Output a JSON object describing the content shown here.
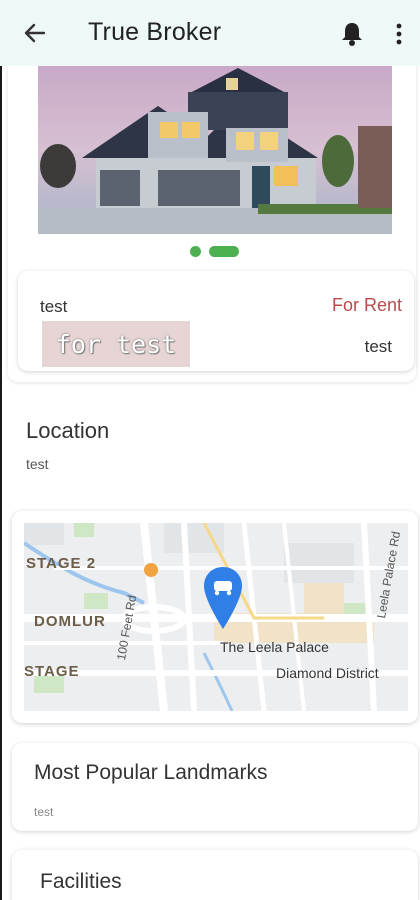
{
  "appbar": {
    "title": "True Broker",
    "back_icon": "arrow-left-icon",
    "notification_icon": "bell-icon",
    "menu_icon": "more-vert-icon"
  },
  "gallery": {
    "image": "house-photo",
    "image_count": 2,
    "active_index": 1
  },
  "listing": {
    "name": "test",
    "status": "For Rent",
    "tag": "for test",
    "price": "test"
  },
  "location": {
    "label": "Location",
    "value": "test"
  },
  "map": {
    "areas": [
      "STAGE 2",
      "DOMLUR",
      "STAGE"
    ],
    "roads": [
      "100 Feet Rd",
      "Leela Palace Rd"
    ],
    "places": [
      "The Leela Palace",
      "Diamond District"
    ],
    "marker_icon": "car-marker-icon"
  },
  "landmarks": {
    "label": "Most Popular Landmarks",
    "value": "test"
  },
  "facilities": {
    "label": "Facilities"
  },
  "colors": {
    "appbar_bg": "#eef8f8",
    "accent_green": "#4caf50",
    "status_red": "#b94a4a",
    "marker_blue": "#2f7fe6"
  }
}
